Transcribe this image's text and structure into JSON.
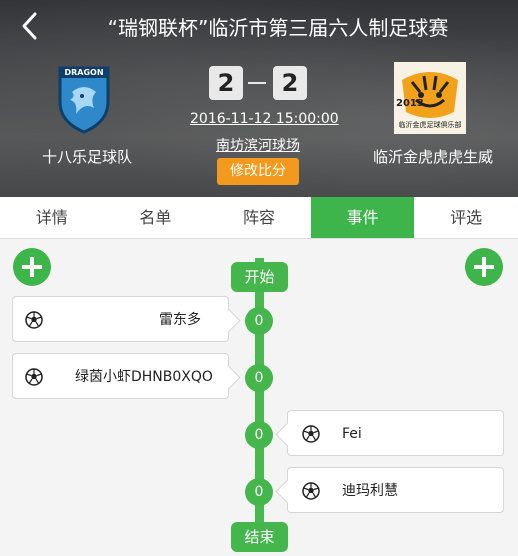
{
  "header": {
    "title": "“瑞钢联杯”临沂市第三届六人制足球赛",
    "home_team": {
      "name": "十八乐足球队",
      "logo_text": "DRAGON"
    },
    "away_team": {
      "name": "临沂金虎虎虎生威",
      "logo_text": "临沂金虎足球俱乐部",
      "logo_year": "2013"
    },
    "home_score": "2",
    "away_score": "2",
    "match_time": "2016-11-12 15:00:00",
    "venue": "南坊滨河球场",
    "edit_score_label": "修改比分"
  },
  "tabs": [
    {
      "label": "详情",
      "active": false
    },
    {
      "label": "名单",
      "active": false
    },
    {
      "label": "阵容",
      "active": false
    },
    {
      "label": "事件",
      "active": true
    },
    {
      "label": "评选",
      "active": false
    }
  ],
  "timeline": {
    "start_label": "开始",
    "end_label": "结束",
    "events": [
      {
        "side": "left",
        "minute": "0",
        "player": "雷东多",
        "icon": "soccer-ball-icon"
      },
      {
        "side": "left",
        "minute": "0",
        "player": "绿茵小虾DHNB0XQO",
        "icon": "soccer-ball-icon"
      },
      {
        "side": "right",
        "minute": "0",
        "player": "Fei",
        "icon": "soccer-ball-icon"
      },
      {
        "side": "right",
        "minute": "0",
        "player": "迪玛利慧",
        "icon": "soccer-ball-icon"
      }
    ]
  },
  "colors": {
    "accent_green": "#3db54a",
    "accent_orange": "#f39a1e"
  }
}
